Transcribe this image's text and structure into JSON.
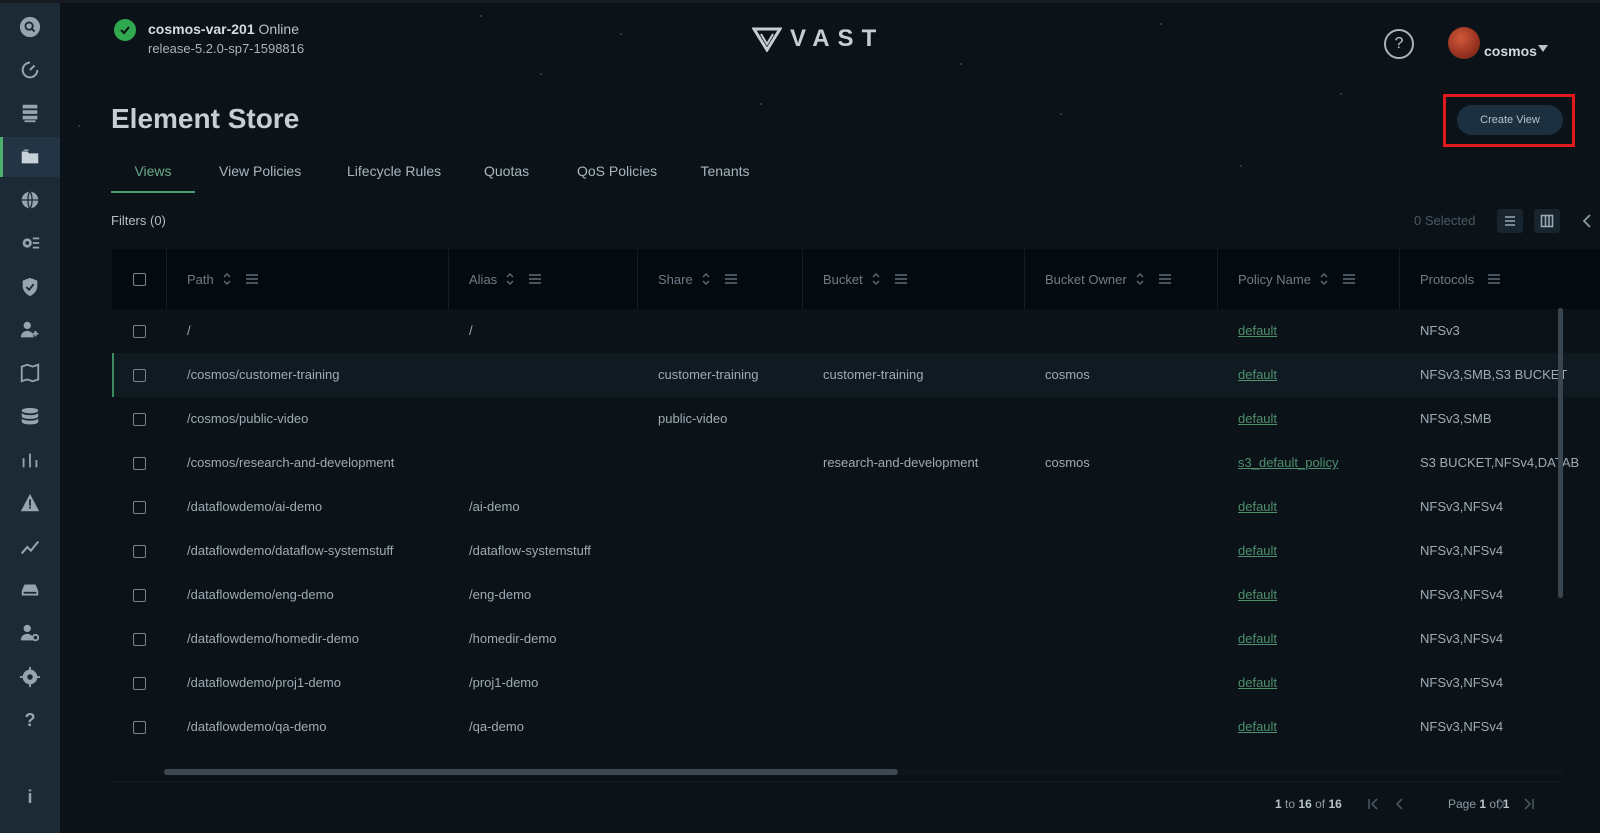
{
  "header": {
    "cluster_name": "cosmos-var-201",
    "cluster_state": "Online",
    "release": "release-5.2.0-sp7-1598816",
    "logo_text": "VAST",
    "help_label": "?",
    "user_name": "cosmos"
  },
  "sidebar": {
    "items": [
      {
        "name": "search"
      },
      {
        "name": "dashboard"
      },
      {
        "name": "infrastructure"
      },
      {
        "name": "element-store",
        "active": true
      },
      {
        "name": "network"
      },
      {
        "name": "services"
      },
      {
        "name": "security"
      },
      {
        "name": "user-management"
      },
      {
        "name": "data-protection"
      },
      {
        "name": "database"
      },
      {
        "name": "analytics"
      },
      {
        "name": "alerts"
      },
      {
        "name": "activity"
      },
      {
        "name": "hardware"
      },
      {
        "name": "administrators"
      },
      {
        "name": "settings"
      },
      {
        "name": "help",
        "label": "?"
      },
      {
        "name": "info",
        "label": "i"
      }
    ]
  },
  "page": {
    "title": "Element Store",
    "create_button": "Create View",
    "tabs": [
      "Views",
      "View Policies",
      "Lifecycle Rules",
      "Quotas",
      "QoS Policies",
      "Tenants"
    ],
    "active_tab": "Views",
    "filters_label": "Filters (0)",
    "selected_label": "0 Selected"
  },
  "table": {
    "columns": [
      "Path",
      "Alias",
      "Share",
      "Bucket",
      "Bucket Owner",
      "Policy Name",
      "Protocols"
    ],
    "rows": [
      {
        "path": "/",
        "alias": "/",
        "share": "",
        "bucket": "",
        "owner": "",
        "policy": "default",
        "protocols": "NFSv3"
      },
      {
        "path": "/cosmos/customer-training",
        "alias": "",
        "share": "customer-training",
        "bucket": "customer-training",
        "owner": "cosmos",
        "policy": "default",
        "protocols": "NFSv3,SMB,S3 BUCKET"
      },
      {
        "path": "/cosmos/public-video",
        "alias": "",
        "share": "public-video",
        "bucket": "",
        "owner": "",
        "policy": "default",
        "protocols": "NFSv3,SMB"
      },
      {
        "path": "/cosmos/research-and-development",
        "alias": "",
        "share": "",
        "bucket": "research-and-development",
        "owner": "cosmos",
        "policy": "s3_default_policy",
        "protocols": "S3 BUCKET,NFSv4,DATAB"
      },
      {
        "path": "/dataflowdemo/ai-demo",
        "alias": "/ai-demo",
        "share": "",
        "bucket": "",
        "owner": "",
        "policy": "default",
        "protocols": "NFSv3,NFSv4"
      },
      {
        "path": "/dataflowdemo/dataflow-systemstuff",
        "alias": "/dataflow-systemstuff",
        "share": "",
        "bucket": "",
        "owner": "",
        "policy": "default",
        "protocols": "NFSv3,NFSv4"
      },
      {
        "path": "/dataflowdemo/eng-demo",
        "alias": "/eng-demo",
        "share": "",
        "bucket": "",
        "owner": "",
        "policy": "default",
        "protocols": "NFSv3,NFSv4"
      },
      {
        "path": "/dataflowdemo/homedir-demo",
        "alias": "/homedir-demo",
        "share": "",
        "bucket": "",
        "owner": "",
        "policy": "default",
        "protocols": "NFSv3,NFSv4"
      },
      {
        "path": "/dataflowdemo/proj1-demo",
        "alias": "/proj1-demo",
        "share": "",
        "bucket": "",
        "owner": "",
        "policy": "default",
        "protocols": "NFSv3,NFSv4"
      },
      {
        "path": "/dataflowdemo/qa-demo",
        "alias": "/qa-demo",
        "share": "",
        "bucket": "",
        "owner": "",
        "policy": "default",
        "protocols": "NFSv3,NFSv4"
      }
    ]
  },
  "pagination": {
    "from": "1",
    "to_word": "to",
    "to": "16",
    "of_word": "of",
    "total": "16",
    "page_word": "Page",
    "page": "1",
    "pages": "1"
  },
  "colors": {
    "accent_green": "#4a9f79",
    "highlight_red": "#e0191f",
    "online_green": "#2fa84f"
  }
}
